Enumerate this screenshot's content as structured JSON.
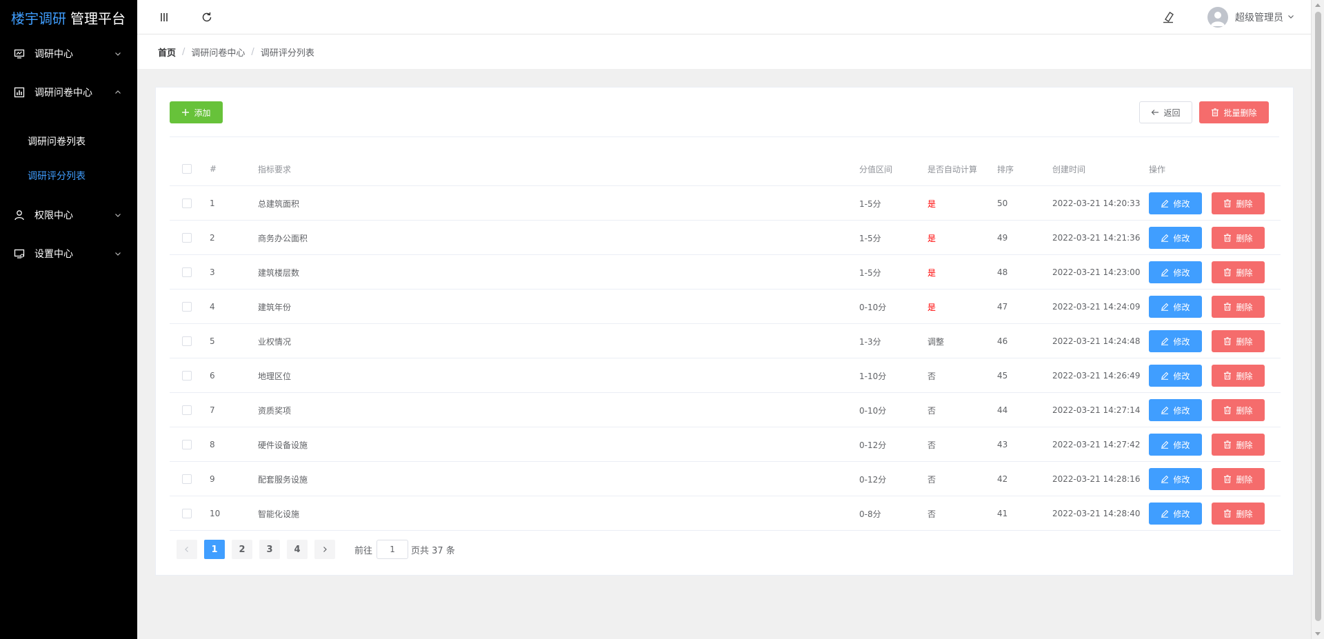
{
  "app": {
    "title_part1": "楼宇调研",
    "title_part2": "管理平台"
  },
  "sidebar": {
    "items": [
      {
        "label": "调研中心",
        "icon": "monitor-icon",
        "expanded": false
      },
      {
        "label": "调研问卷中心",
        "icon": "bar-chart-icon",
        "expanded": true,
        "children": [
          {
            "label": "调研问卷列表",
            "active": false
          },
          {
            "label": "调研评分列表",
            "active": true
          }
        ]
      },
      {
        "label": "权限中心",
        "icon": "user-icon",
        "expanded": false
      },
      {
        "label": "设置中心",
        "icon": "monitor-settings-icon",
        "expanded": false
      }
    ]
  },
  "header": {
    "menu_toggle_icon": "bars-icon",
    "refresh_icon": "refresh-icon",
    "eraser_icon": "eraser-icon",
    "user_name": "超级管理员"
  },
  "breadcrumb": [
    "首页",
    "调研问卷中心",
    "调研评分列表"
  ],
  "toolbar": {
    "add_label": "添加",
    "back_label": "返回",
    "batch_delete_label": "批量删除"
  },
  "table": {
    "columns": {
      "index": "#",
      "requirement": "指标要求",
      "score_range": "分值区间",
      "auto_calc": "是否自动计算",
      "sort": "排序",
      "created": "创建时间",
      "actions": "操作"
    },
    "edit_label": "修改",
    "delete_label": "删除",
    "rows": [
      {
        "index": "1",
        "requirement": "总建筑面积",
        "score_range": "1-5分",
        "auto_calc": "是",
        "sort": "50",
        "created": "2022-03-21 14:20:33"
      },
      {
        "index": "2",
        "requirement": "商务办公面积",
        "score_range": "1-5分",
        "auto_calc": "是",
        "sort": "49",
        "created": "2022-03-21 14:21:36"
      },
      {
        "index": "3",
        "requirement": "建筑楼层数",
        "score_range": "1-5分",
        "auto_calc": "是",
        "sort": "48",
        "created": "2022-03-21 14:23:00"
      },
      {
        "index": "4",
        "requirement": "建筑年份",
        "score_range": "0-10分",
        "auto_calc": "是",
        "sort": "47",
        "created": "2022-03-21 14:24:09"
      },
      {
        "index": "5",
        "requirement": "业权情况",
        "score_range": "1-3分",
        "auto_calc": "调整",
        "sort": "46",
        "created": "2022-03-21 14:24:48"
      },
      {
        "index": "6",
        "requirement": "地理区位",
        "score_range": "1-10分",
        "auto_calc": "否",
        "sort": "45",
        "created": "2022-03-21 14:26:49"
      },
      {
        "index": "7",
        "requirement": "资质奖项",
        "score_range": "0-10分",
        "auto_calc": "否",
        "sort": "44",
        "created": "2022-03-21 14:27:14"
      },
      {
        "index": "8",
        "requirement": "硬件设备设施",
        "score_range": "0-12分",
        "auto_calc": "否",
        "sort": "43",
        "created": "2022-03-21 14:27:42"
      },
      {
        "index": "9",
        "requirement": "配套服务设施",
        "score_range": "0-12分",
        "auto_calc": "否",
        "sort": "42",
        "created": "2022-03-21 14:28:16"
      },
      {
        "index": "10",
        "requirement": "智能化设施",
        "score_range": "0-8分",
        "auto_calc": "否",
        "sort": "41",
        "created": "2022-03-21 14:28:40"
      }
    ]
  },
  "pagination": {
    "pages": [
      "1",
      "2",
      "3",
      "4"
    ],
    "current": "1",
    "goto_prefix": "前往",
    "goto_value": "1",
    "total_text": "页共 37 条"
  },
  "colors": {
    "accent": "#409eff",
    "success": "#67c23a",
    "danger": "#f56c6c",
    "yes_text": "#ff0000",
    "sidebar_bg": "#000000"
  }
}
